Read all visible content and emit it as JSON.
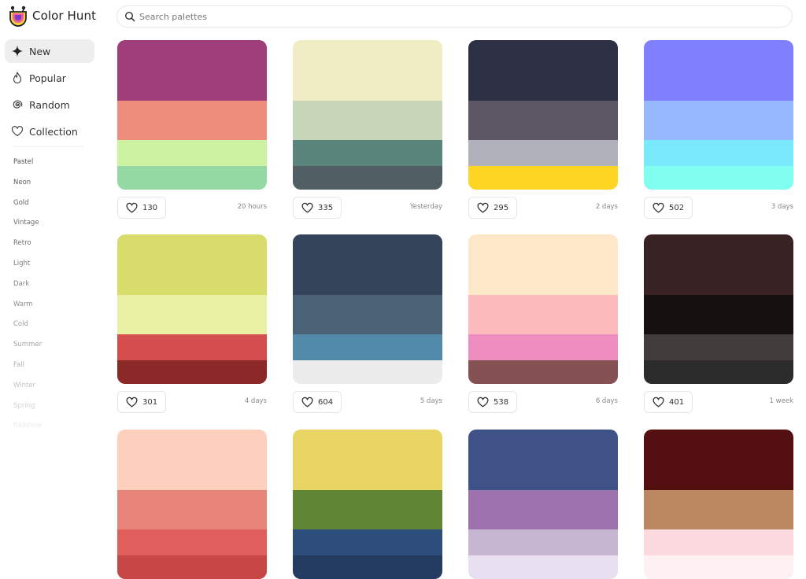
{
  "app": {
    "name": "Color Hunt"
  },
  "search": {
    "placeholder": "Search palettes"
  },
  "nav": [
    {
      "label": "New",
      "icon": "sparkle-icon",
      "active": true
    },
    {
      "label": "Popular",
      "icon": "flame-icon",
      "active": false
    },
    {
      "label": "Random",
      "icon": "spiral-icon",
      "active": false
    },
    {
      "label": "Collection",
      "icon": "heart-icon",
      "active": false
    }
  ],
  "tags": [
    {
      "label": "Pastel",
      "color": "#555555"
    },
    {
      "label": "Neon",
      "color": "#5c5c5c"
    },
    {
      "label": "Gold",
      "color": "#636363"
    },
    {
      "label": "Vintage",
      "color": "#6a6a6a"
    },
    {
      "label": "Retro",
      "color": "#727272"
    },
    {
      "label": "Light",
      "color": "#7b7b7b"
    },
    {
      "label": "Dark",
      "color": "#858585"
    },
    {
      "label": "Warm",
      "color": "#8f8f8f"
    },
    {
      "label": "Cold",
      "color": "#9a9a9a"
    },
    {
      "label": "Summer",
      "color": "#a6a6a6"
    },
    {
      "label": "Fall",
      "color": "#b4b4b4"
    },
    {
      "label": "Winter",
      "color": "#c4c4c4"
    },
    {
      "label": "Spring",
      "color": "#d4d4d4"
    },
    {
      "label": "Rainbow",
      "color": "#ececec"
    }
  ],
  "palettes": [
    {
      "colors": [
        "#a03d7b",
        "#ef8d7c",
        "#cdf3a2",
        "#94d9a4"
      ],
      "likes": "130",
      "date": "20 hours"
    },
    {
      "colors": [
        "#f0ecc4",
        "#c8d7b9",
        "#5a857d",
        "#515f64"
      ],
      "likes": "335",
      "date": "Yesterday"
    },
    {
      "colors": [
        "#2d2f45",
        "#5c5665",
        "#b0b1ba",
        "#fdd522"
      ],
      "likes": "295",
      "date": "2 days"
    },
    {
      "colors": [
        "#7f80fe",
        "#98b8fe",
        "#7ae9fb",
        "#80fef0"
      ],
      "likes": "502",
      "date": "3 days"
    },
    {
      "colors": [
        "#d8dc6b",
        "#eaf0a4",
        "#d44e4e",
        "#8b2828"
      ],
      "likes": "301",
      "date": "4 days"
    },
    {
      "colors": [
        "#33445b",
        "#4a6274",
        "#528aaa",
        "#ececec"
      ],
      "likes": "604",
      "date": "5 days"
    },
    {
      "colors": [
        "#fde8c9",
        "#fdbabd",
        "#f08dc0",
        "#845253"
      ],
      "likes": "538",
      "date": "6 days"
    },
    {
      "colors": [
        "#382224",
        "#161010",
        "#423c3b",
        "#2c2c2c"
      ],
      "likes": "401",
      "date": "1 week"
    },
    {
      "colors": [
        "#fdd0bd",
        "#e8847a",
        "#e05e5b",
        "#c74747"
      ],
      "likes": "",
      "date": ""
    },
    {
      "colors": [
        "#e9d564",
        "#5f8535",
        "#2d4e7c",
        "#243c60"
      ],
      "likes": "",
      "date": ""
    },
    {
      "colors": [
        "#3e5287",
        "#9b72ad",
        "#c7b6d1",
        "#e8dff0"
      ],
      "likes": "",
      "date": ""
    },
    {
      "colors": [
        "#540f10",
        "#bb8862",
        "#fddadf",
        "#fff0f2"
      ],
      "likes": "",
      "date": ""
    }
  ]
}
